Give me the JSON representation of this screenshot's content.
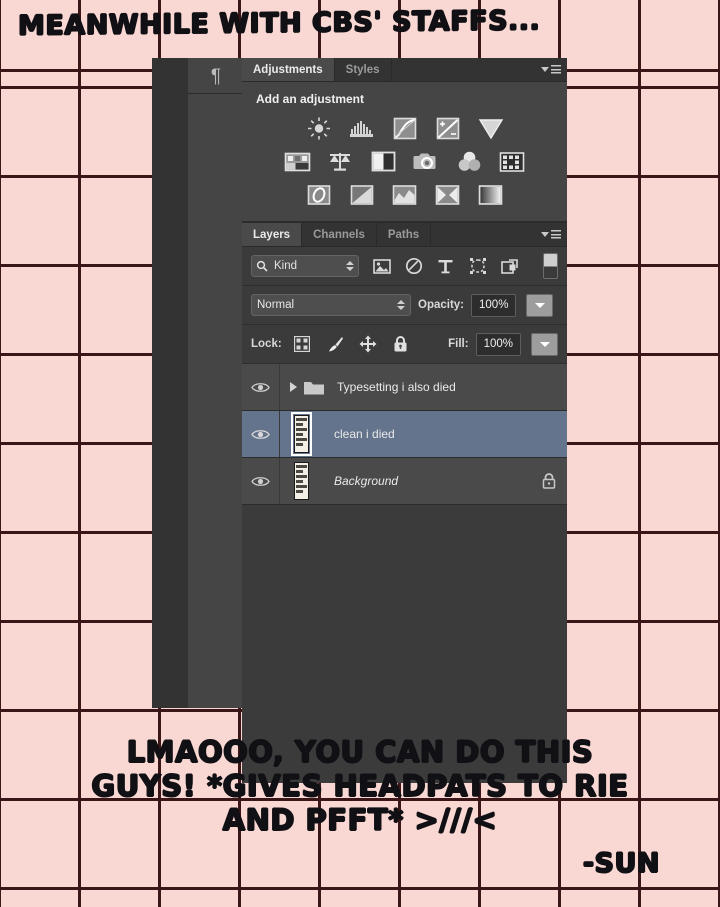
{
  "meme": {
    "top_caption": "MEANWHILE WITH CBS' STAFFS...",
    "bottom_caption": "LMAOOO, YOU CAN DO THIS\nGUYS! *GIVES HEADPATS TO RIE\nAND PFFT* >///<",
    "signature": "-SUN",
    "background_color": "#f9d7d3",
    "grid_line_color": "#3a1618",
    "text_color": "#111014"
  },
  "app": {
    "name": "photoshop-panels",
    "dock_background": "#3c3c3c",
    "rail_icon": "pilcrow-icon",
    "rail_icon_glyph": "¶"
  },
  "adjustments_panel": {
    "tabs": [
      {
        "label": "Adjustments",
        "active": true
      },
      {
        "label": "Styles",
        "active": false
      }
    ],
    "menu_icon": "panel-menu-icon",
    "title": "Add an adjustment",
    "rows": [
      [
        {
          "name": "brightness-contrast-icon"
        },
        {
          "name": "levels-icon"
        },
        {
          "name": "curves-icon"
        },
        {
          "name": "exposure-icon"
        },
        {
          "name": "vibrance-icon"
        }
      ],
      [
        {
          "name": "hue-saturation-icon"
        },
        {
          "name": "color-balance-icon"
        },
        {
          "name": "black-and-white-icon"
        },
        {
          "name": "photo-filter-icon"
        },
        {
          "name": "channel-mixer-icon"
        },
        {
          "name": "color-lookup-icon"
        }
      ],
      [
        {
          "name": "invert-icon"
        },
        {
          "name": "posterize-icon"
        },
        {
          "name": "threshold-icon"
        },
        {
          "name": "selective-color-icon"
        },
        {
          "name": "gradient-map-icon"
        }
      ]
    ]
  },
  "layers_panel": {
    "tabs": [
      {
        "label": "Layers",
        "active": true
      },
      {
        "label": "Channels",
        "active": false
      },
      {
        "label": "Paths",
        "active": false
      }
    ],
    "menu_icon": "panel-menu-icon",
    "filter": {
      "search_icon": "search-icon",
      "kind_label": "Kind",
      "icons": [
        "pixel-layer-filter-icon",
        "adjustment-layer-filter-icon",
        "type-layer-filter-icon",
        "shape-layer-filter-icon",
        "smart-object-filter-icon"
      ],
      "toggle_name": "filter-enable-toggle"
    },
    "blend": {
      "mode": "Normal",
      "opacity_label": "Opacity:",
      "opacity_value": "100%"
    },
    "lock": {
      "label": "Lock:",
      "icons": [
        "lock-transparency-icon",
        "lock-image-pixels-icon",
        "lock-position-icon",
        "lock-all-icon"
      ],
      "fill_label": "Fill:",
      "fill_value": "100%"
    },
    "layers": [
      {
        "name": "Typesetting i also died",
        "type": "group",
        "visible": true,
        "selected": false,
        "locked": false,
        "italic": false
      },
      {
        "name": "clean i died",
        "type": "pixel",
        "visible": true,
        "selected": true,
        "locked": false,
        "italic": false
      },
      {
        "name": "Background",
        "type": "pixel",
        "visible": true,
        "selected": false,
        "locked": true,
        "italic": true
      }
    ]
  }
}
